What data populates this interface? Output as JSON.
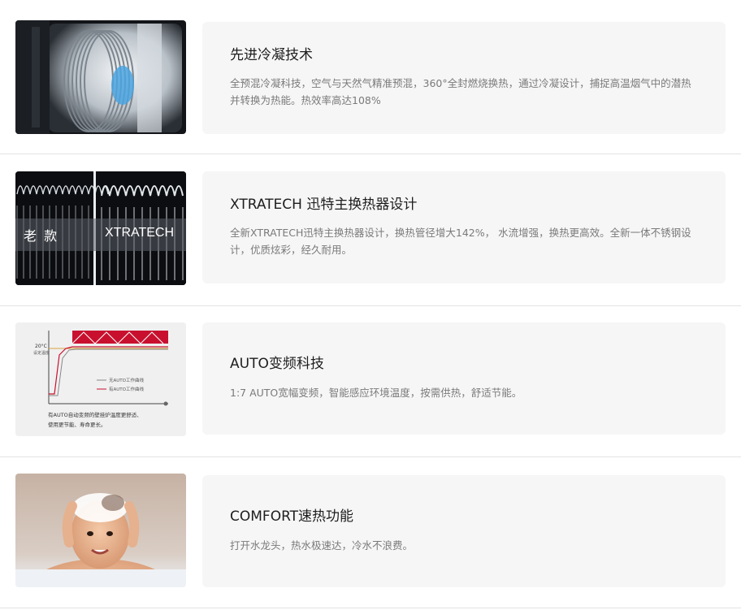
{
  "features": [
    {
      "title": "先进冷凝技术",
      "desc": "全预混冷凝科技，空气与天然气精准预混，360°全封燃烧换热，通过冷凝设计，捕捉高温烟气中的潜热并转换为热能。热效率高达108%",
      "image_icon": "condensing-heat-exchanger-image"
    },
    {
      "title": "XTRATECH 迅特主换热器设计",
      "desc": "全新XTRATECH迅特主换热器设计，换热管径增大142%， 水流增强，换热更高效。全新一体不锈钢设计，优质炫彩，经久耐用。",
      "image_icon": "heat-exchanger-comparison-image",
      "image_labels": {
        "left": "老 款",
        "right": "XTRATECH"
      }
    },
    {
      "title": "AUTO变频科技",
      "desc": "1:7 AUTO宽幅变频，智能感应环境温度，按需供热，舒适节能。",
      "image_icon": "auto-frequency-chart-image",
      "image_labels": {
        "temp": "20°C",
        "temp_sub": "设定温度",
        "legend_no_auto": "无AUTO工作曲线",
        "legend_auto": "有AUTO工作曲线",
        "caption_line1": "有AUTO自动变频的壁挂炉温度更舒适、",
        "caption_line2": "使用更节能、寿命更长。"
      }
    },
    {
      "title": "COMFORT速热功能",
      "desc": "打开水龙头，热水极速达，冷水不浪费。",
      "image_icon": "baby-bath-photo"
    }
  ],
  "colors": {
    "card_bg": "#f6f6f6",
    "title": "#1d1d1d",
    "desc": "#7a7a7a",
    "divider": "#e3e3e3",
    "chart_red": "#c8102e"
  }
}
